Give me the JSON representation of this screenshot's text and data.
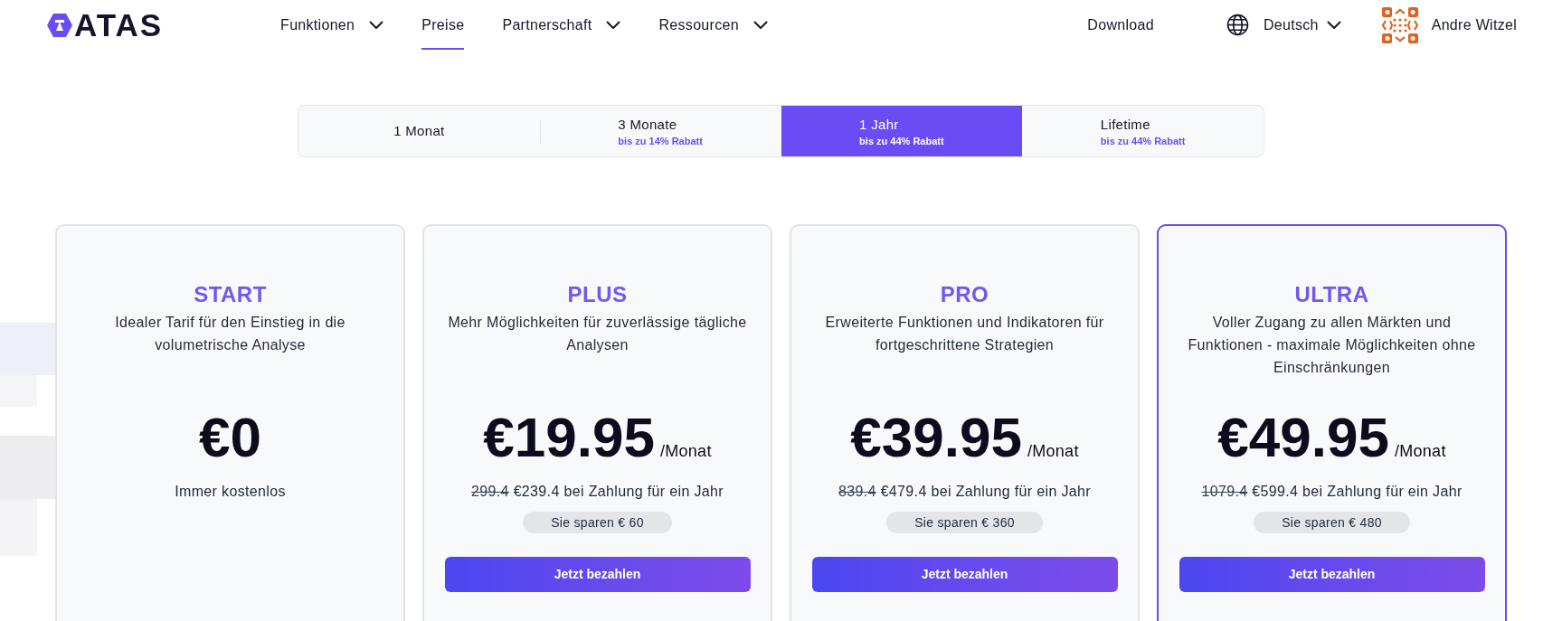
{
  "header": {
    "logo": {
      "text": "ATAS"
    },
    "nav": [
      {
        "label": "Funktionen",
        "has_menu": true,
        "selected": false
      },
      {
        "label": "Preise",
        "has_menu": false,
        "selected": true
      },
      {
        "label": "Partnerschaft",
        "has_menu": true,
        "selected": false
      },
      {
        "label": "Ressourcen",
        "has_menu": true,
        "selected": false
      }
    ],
    "download": "Download",
    "language": {
      "label": "Deutsch"
    },
    "user": {
      "name": "Andre Witzel"
    }
  },
  "billing_tabs": [
    {
      "label": "1 Monat",
      "selected": false
    },
    {
      "label": "3 Monate",
      "discount": "bis zu 14% Rabatt",
      "selected": false
    },
    {
      "label": "1 Jahr",
      "discount": "bis zu 44% Rabatt",
      "selected": true
    },
    {
      "label": "Lifetime",
      "discount": "bis zu 44% Rabatt",
      "selected": false
    }
  ],
  "plans": [
    {
      "name": "START",
      "description": "Idealer Tarif für den Einstieg in die volumetrische Analyse",
      "price": "€0",
      "note": "Immer kostenlos",
      "highlighted": false
    },
    {
      "name": "PLUS",
      "description": "Mehr Möglichkeiten für zuverlässige tägliche Analysen",
      "price": "€19.95",
      "period": "/Monat",
      "old_price": "299.4",
      "yearly_price": "€239.4 bei Zahlung für ein Jahr",
      "savings": "Sie sparen € 60",
      "button": "Jetzt bezahlen",
      "highlighted": false
    },
    {
      "name": "PRO",
      "description": "Erweiterte Funktionen und Indikatoren für fortgeschrittene Strategien",
      "price": "€39.95",
      "period": "/Monat",
      "old_price": "839.4",
      "yearly_price": "€479.4 bei Zahlung für ein Jahr",
      "savings": "Sie sparen € 360",
      "button": "Jetzt bezahlen",
      "highlighted": false
    },
    {
      "name": "ULTRA",
      "description": "Voller Zugang zu allen Märkten und Funktionen - maximale Möglichkeiten ohne Einschränkungen",
      "price": "€49.95",
      "period": "/Monat",
      "old_price": "1079.4",
      "yearly_price": "€599.4 bei Zahlung für ein Jahr",
      "savings": "Sie sparen € 480",
      "button": "Jetzt bezahlen",
      "highlighted": true
    }
  ]
}
